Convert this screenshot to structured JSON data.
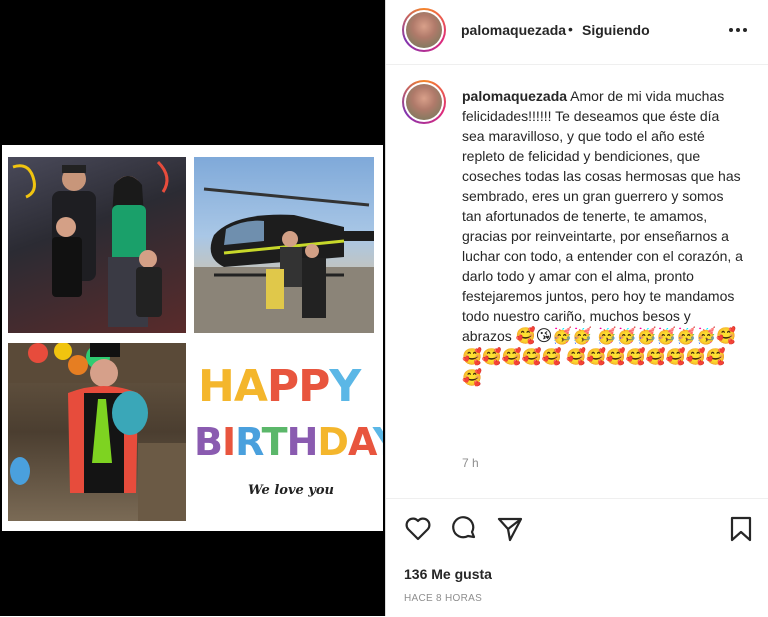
{
  "post": {
    "username": "palomaquezada",
    "separator": "•",
    "follow_status": "Siguiendo",
    "more_icon": "more-horizontal-icon",
    "caption": {
      "username": "palomaquezada",
      "text": "Amor de mi vida muchas felicidades!!!!!! Te deseamos que éste día sea maravilloso, y que todo el año esté repleto de felicidad y bendiciones, que coseches todas las cosas hermosas que has sembrado, eres un gran guerrero y somos tan afortunados de tenerte, te amamos, gracias por reinveintarte, por enseñarnos a luchar con todo, a entender con el corazón, a darlo todo y amar con el alma, pronto festejaremos juntos, pero hoy te mandamos todo nuestro cariño, muchos besos y abrazos",
      "emojis": "🥰😘🥳🥳 🥳🥳🥳🥳🥳🥳🥰🥰🥰🥰🥰🥰 🥰🥰🥰🥰🥰🥰🥰🥰🥰"
    },
    "time_since": "7 h",
    "likes": "136 Me gusta",
    "timestamp": "HACE 8 HORAS"
  },
  "image": {
    "happy": [
      "H",
      "A",
      "P",
      "P",
      "Y"
    ],
    "birthday": [
      "B",
      "I",
      "R",
      "T",
      "H",
      "D",
      "A",
      "Y"
    ],
    "happy_colors": [
      "#f4b62c",
      "#f4b62c",
      "#e8553e",
      "#e8553e",
      "#5bb7e6"
    ],
    "birthday_colors": [
      "#8a5bb0",
      "#e8553e",
      "#4aa0dd",
      "#5bb76a",
      "#8a5bb0",
      "#f4b62c",
      "#e8553e",
      "#5bb7e6"
    ],
    "tagline": "We love you"
  }
}
